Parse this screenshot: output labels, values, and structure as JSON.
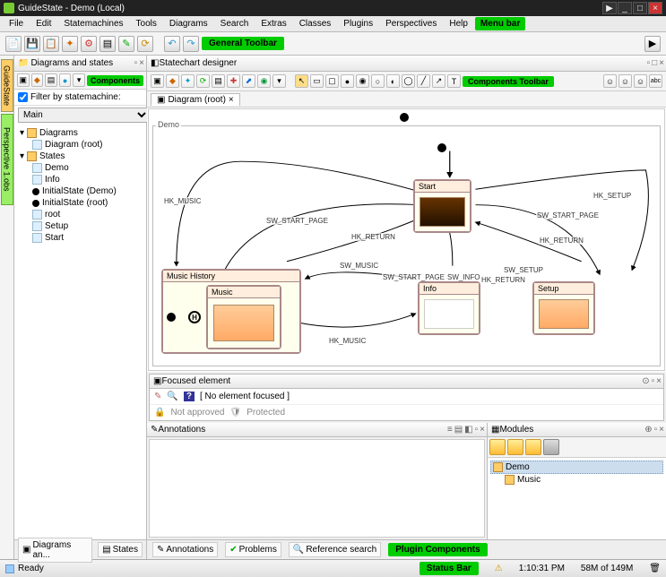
{
  "window": {
    "title": "GuideState - Demo (Local)"
  },
  "menubar": {
    "items": [
      "File",
      "Edit",
      "Statemachines",
      "Tools",
      "Diagrams",
      "Search",
      "Extras",
      "Classes",
      "Plugins",
      "Perspectives",
      "Help"
    ],
    "label_menu_bar": "Menu bar"
  },
  "main_toolbar": {
    "label": "General Toolbar"
  },
  "left_tabs": {
    "guide_state": "GuideState",
    "perspective": "Perspective 1.obs"
  },
  "diagrams_panel": {
    "title": "Diagrams and states",
    "components_label": "Components",
    "filter_label": "Filter by statemachine:",
    "filter_value": "Main",
    "tree": {
      "diagrams": {
        "label": "Diagrams",
        "items": [
          "Diagram (root)"
        ]
      },
      "states": {
        "label": "States",
        "items": [
          "Demo",
          "Info",
          "InitialState (Demo)",
          "InitialState (root)",
          "root",
          "Setup",
          "Start"
        ]
      }
    },
    "bottom_tabs": [
      "Diagrams an...",
      "States"
    ]
  },
  "designer": {
    "title": "Statechart designer",
    "components_toolbar_label": "Components Toolbar",
    "tab": "Diagram (root)",
    "root_label": "Demo",
    "states": {
      "start": "Start",
      "music": "Music",
      "music_history": "Music History",
      "info": "Info",
      "setup": "Setup"
    },
    "edges": {
      "hk_music": "HK_MUSIC",
      "sw_start_page": "SW_START_PAGE",
      "hk_setup": "HK_SETUP",
      "hk_return": "HK_RETURN",
      "sw_music": "SW_MUSIC",
      "sw_start_page2": "SW_START_PAGE",
      "sw_info": "SW_INFO",
      "sw_setup": "SW_SETUP",
      "hk_return2": "HK_RETURN",
      "hk_return3": "HK_RETURN",
      "hk_music2": "HK_MUSIC"
    },
    "history_marker": "H"
  },
  "focused": {
    "title": "Focused element",
    "none": "[ No element focused ]",
    "not_approved": "Not approved",
    "protected": "Protected"
  },
  "annotations": {
    "title": "Annotations"
  },
  "modules": {
    "title": "Modules",
    "items": [
      "Demo",
      "Music"
    ]
  },
  "plugin_tabs": {
    "annotations": "Annotations",
    "problems": "Problems",
    "reference": "Reference search",
    "label": "Plugin Components"
  },
  "statusbar": {
    "ready": "Ready",
    "status_bar_label": "Status Bar",
    "time": "1:10:31 PM",
    "memory": "58M of 149M"
  }
}
